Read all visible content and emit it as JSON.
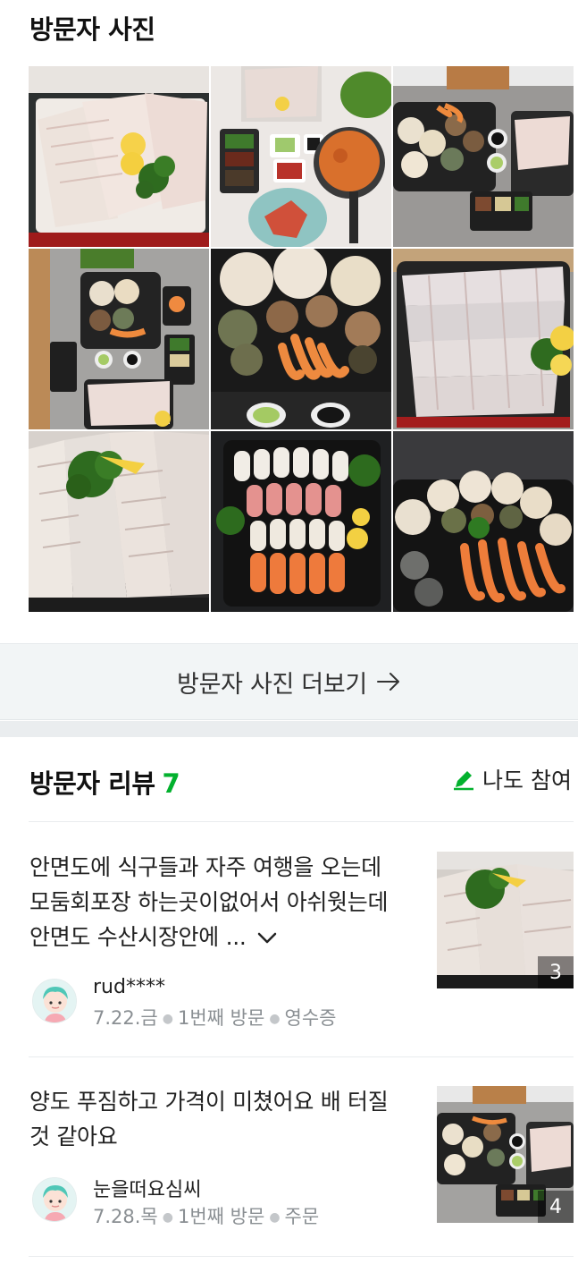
{
  "photos": {
    "title": "방문자 사진",
    "items": [
      {
        "name": "photo-sliced-fish-lemon"
      },
      {
        "name": "photo-table-sauces-stew"
      },
      {
        "name": "photo-shellfish-platter-table"
      },
      {
        "name": "photo-tray-overview"
      },
      {
        "name": "photo-shellfish-shrimp"
      },
      {
        "name": "photo-fish-platter"
      },
      {
        "name": "photo-sashimi-closeup"
      },
      {
        "name": "photo-sushi-platter"
      },
      {
        "name": "photo-scallops-shrimp"
      }
    ],
    "more_label": "방문자 사진 더보기"
  },
  "reviews": {
    "title": "방문자 리뷰",
    "count": "7",
    "join_label": "나도 참여",
    "accent": "#03b12e",
    "items": [
      {
        "text": "안면도에 식구들과 자주 여행을 오는데 모둠회포장 하는곳이없어서 아쉬웟는데 안면도 수산시장안에 ...",
        "author": "rud****",
        "date": "7.22.금",
        "visit": "1번째 방문",
        "type": "영수증",
        "photo_count": "3"
      },
      {
        "text": "양도 푸짐하고 가격이 미쳤어요 배 터질것 같아요",
        "author": "눈을떠요심씨",
        "date": "7.28.목",
        "visit": "1번째 방문",
        "type": "주문",
        "photo_count": "4"
      }
    ]
  }
}
